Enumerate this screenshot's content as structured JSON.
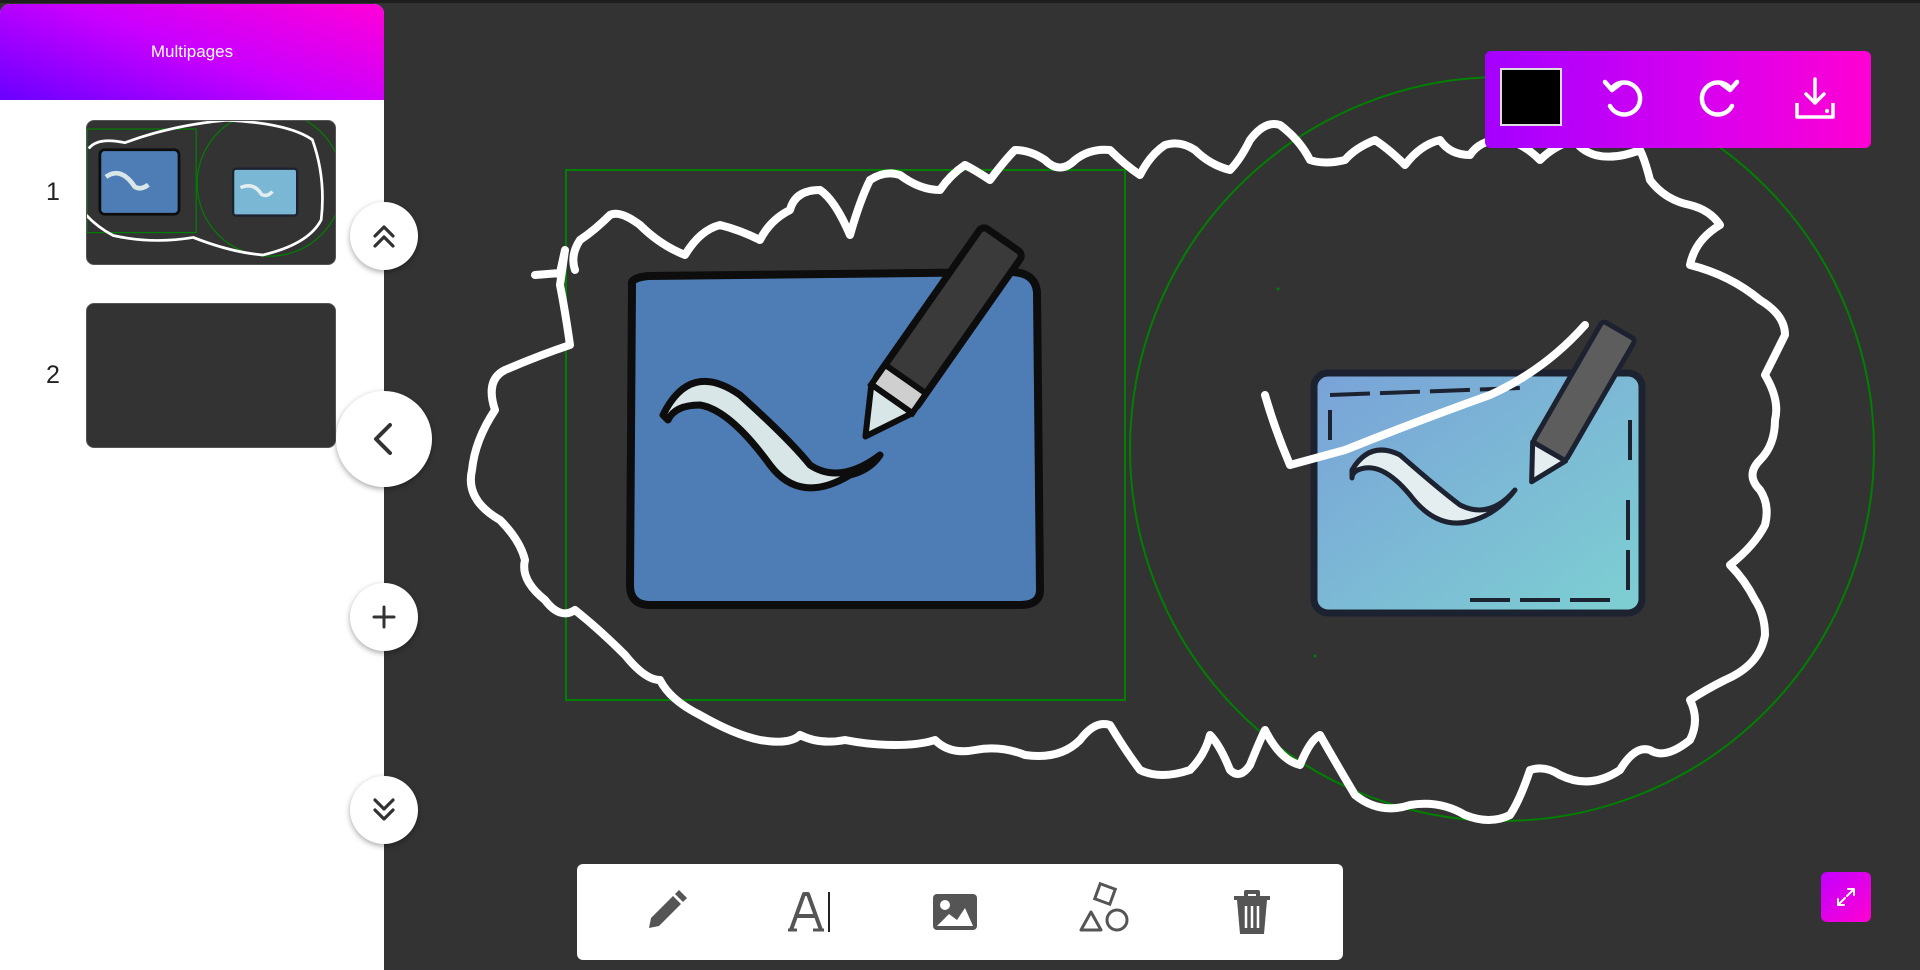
{
  "sidebar": {
    "title": "Multipages",
    "pages": [
      {
        "number": "1",
        "has_content": true
      },
      {
        "number": "2",
        "has_content": false
      }
    ]
  },
  "nav": {
    "scroll_up_icon": "double-chevron-up-icon",
    "collapse_icon": "chevron-left-icon",
    "add_page_icon": "plus-icon",
    "scroll_down_icon": "double-chevron-down-icon"
  },
  "toolbar": {
    "current_color": "#000000",
    "undo_icon": "undo-icon",
    "redo_icon": "redo-icon",
    "download_icon": "download-icon"
  },
  "tools": [
    {
      "name": "pencil",
      "icon": "pencil-icon"
    },
    {
      "name": "text",
      "icon": "text-icon"
    },
    {
      "name": "image",
      "icon": "image-icon"
    },
    {
      "name": "shapes",
      "icon": "shapes-icon"
    },
    {
      "name": "delete",
      "icon": "trash-icon"
    }
  ],
  "expand": {
    "icon": "expand-icon"
  },
  "colors": {
    "canvas_bg": "#333333",
    "accent_start": "#a400ff",
    "accent_end": "#ff00d2",
    "shape_outline": "#008000",
    "stroke": "#ffffff"
  }
}
